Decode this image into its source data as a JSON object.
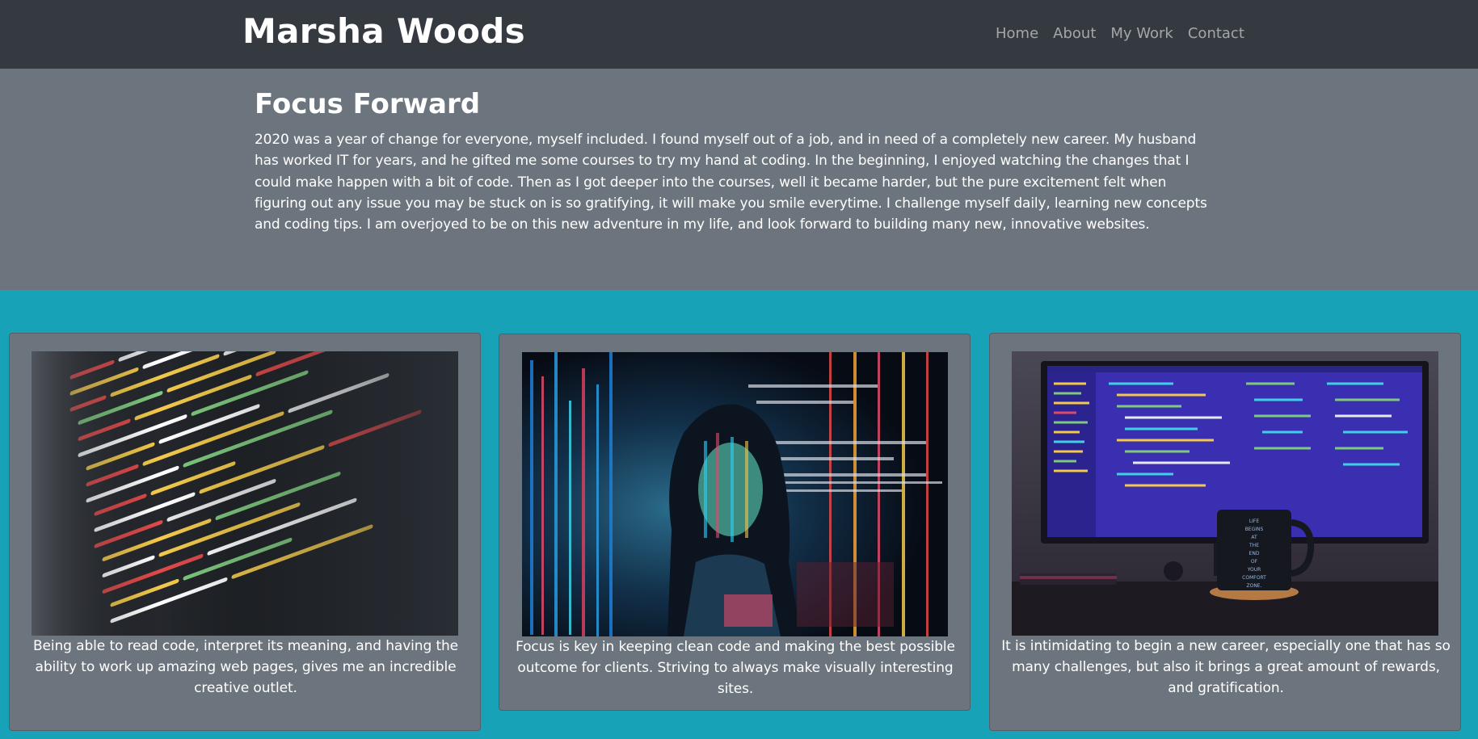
{
  "navbar": {
    "brand": "Marsha Woods",
    "links": [
      "Home",
      "About",
      "My Work",
      "Contact"
    ]
  },
  "hero": {
    "title": "Focus Forward",
    "text": "2020 was a year of change for everyone, myself included. I found myself out of a job, and in need of a completely new career. My husband has worked IT for years, and he gifted me some courses to try my hand at coding. In the beginning, I enjoyed watching the changes that I could make happen with a bit of code. Then as I got deeper into the courses, well it became harder, but the pure excitement felt when figuring out any issue you may be stuck on is so gratifying, it will make you smile everytime. I challenge myself daily, learning new concepts and coding tips. I am overjoyed to be on this new adventure in my life, and look forward to building many new, innovative websites."
  },
  "cards": [
    {
      "image": "code-closeup-photo",
      "caption": "Being able to read code, interpret its meaning, and having the ability to work up amazing web pages, gives me an incredible creative outlet."
    },
    {
      "image": "woman-code-projection-photo",
      "caption": "Focus is key in keeping clean code and making the best possible outcome for clients. Striving to always make visually interesting sites."
    },
    {
      "image": "monitor-and-mug-photo",
      "caption": "It is intimidating to begin a new career, especially one that has so many challenges, but also it brings a great amount of rewards, and gratification.",
      "mug_text": "LIFE BEGINS AT THE END OF YOUR COMFORT ZONE."
    }
  ],
  "colors": {
    "navbar_bg": "#343a40",
    "hero_bg": "#6c757d",
    "page_bg": "#17a2b8",
    "card_bg": "#6c757d"
  }
}
